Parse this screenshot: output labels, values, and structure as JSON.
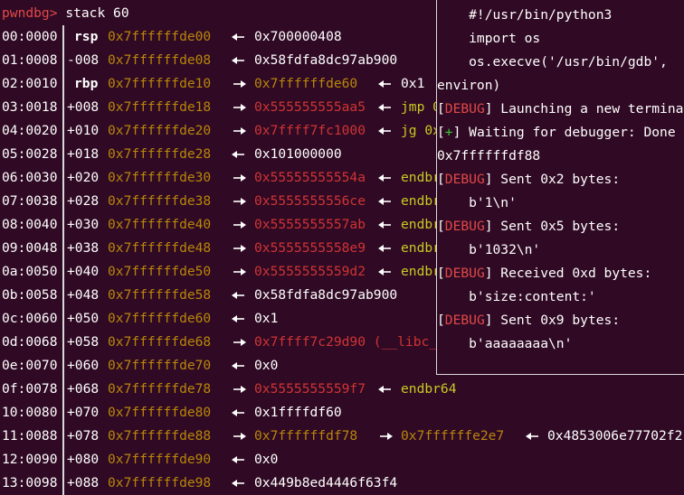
{
  "prompt": {
    "name": "pwndbg>",
    "command": "stack 60"
  },
  "stack": [
    {
      "off": "00:0000",
      "reg": "rsp",
      "roff": "",
      "addr": "0x7ffffffde00",
      "arrow": "left",
      "v1": "0x700000408",
      "v1c": "white",
      "v2": "",
      "v2c": "",
      "v3": "",
      "v3c": ""
    },
    {
      "off": "01:0008",
      "reg": "",
      "roff": "-008",
      "addr": "0x7ffffffde08",
      "arrow": "left",
      "v1": "0x58fdfa8dc97ab900",
      "v1c": "white",
      "v2": "",
      "v2c": "",
      "v3": "",
      "v3c": ""
    },
    {
      "off": "02:0010",
      "reg": "rbp",
      "roff": "",
      "addr": "0x7ffffffde10",
      "arrow": "right",
      "v1": "0x7ffffffde60",
      "v1c": "gold",
      "arrow2": "left",
      "v2": "0x1",
      "v2c": "white",
      "v3": "",
      "v3c": ""
    },
    {
      "off": "03:0018",
      "reg": "",
      "roff": "+008",
      "addr": "0x7ffffffde18",
      "arrow": "right",
      "v1": "0x555555555aa5",
      "v1c": "red",
      "arrow2": "left",
      "v2": "jmp 0",
      "v2c": "yellow",
      "v3": "",
      "v3c": ""
    },
    {
      "off": "04:0020",
      "reg": "",
      "roff": "+010",
      "addr": "0x7ffffffde20",
      "arrow": "right",
      "v1": "0x7ffff7fc1000",
      "v1c": "red",
      "arrow2": "left",
      "v2": "jg 0x",
      "v2c": "yellow",
      "v3": "",
      "v3c": ""
    },
    {
      "off": "05:0028",
      "reg": "",
      "roff": "+018",
      "addr": "0x7ffffffde28",
      "arrow": "left",
      "v1": "0x101000000",
      "v1c": "white",
      "v2": "",
      "v2c": "",
      "v3": "",
      "v3c": ""
    },
    {
      "off": "06:0030",
      "reg": "",
      "roff": "+020",
      "addr": "0x7ffffffde30",
      "arrow": "right",
      "v1": "0x55555555554a",
      "v1c": "red",
      "arrow2": "left",
      "v2": "endbr",
      "v2c": "yellow",
      "v3": "",
      "v3c": ""
    },
    {
      "off": "07:0038",
      "reg": "",
      "roff": "+028",
      "addr": "0x7ffffffde38",
      "arrow": "right",
      "v1": "0x5555555556ce",
      "v1c": "red",
      "arrow2": "left",
      "v2": "endbr",
      "v2c": "yellow",
      "v3": "",
      "v3c": ""
    },
    {
      "off": "08:0040",
      "reg": "",
      "roff": "+030",
      "addr": "0x7ffffffde40",
      "arrow": "right",
      "v1": "0x5555555557ab",
      "v1c": "red",
      "arrow2": "left",
      "v2": "endbr",
      "v2c": "yellow",
      "v3": "",
      "v3c": ""
    },
    {
      "off": "09:0048",
      "reg": "",
      "roff": "+038",
      "addr": "0x7ffffffde48",
      "arrow": "right",
      "v1": "0x5555555558e9",
      "v1c": "red",
      "arrow2": "left",
      "v2": "endbr",
      "v2c": "yellow",
      "v3": "",
      "v3c": ""
    },
    {
      "off": "0a:0050",
      "reg": "",
      "roff": "+040",
      "addr": "0x7ffffffde50",
      "arrow": "right",
      "v1": "0x5555555559d2",
      "v1c": "red",
      "arrow2": "left",
      "v2": "endbr",
      "v2c": "yellow",
      "v3": "",
      "v3c": ""
    },
    {
      "off": "0b:0058",
      "reg": "",
      "roff": "+048",
      "addr": "0x7ffffffde58",
      "arrow": "left",
      "v1": "0x58fdfa8dc97ab900",
      "v1c": "white",
      "v2": "",
      "v2c": "",
      "v3": "",
      "v3c": ""
    },
    {
      "off": "0c:0060",
      "reg": "",
      "roff": "+050",
      "addr": "0x7ffffffde60",
      "arrow": "left",
      "v1": "0x1",
      "v1c": "white",
      "v2": "",
      "v2c": "",
      "v3": "",
      "v3c": ""
    },
    {
      "off": "0d:0068",
      "reg": "",
      "roff": "+058",
      "addr": "0x7ffffffde68",
      "arrow": "right",
      "v1": "0x7ffff7c29d90 (__libc_",
      "v1c": "red",
      "v2": "",
      "v2c": "",
      "v3": "",
      "v3c": ""
    },
    {
      "off": "0e:0070",
      "reg": "",
      "roff": "+060",
      "addr": "0x7ffffffde70",
      "arrow": "left",
      "v1": "0x0",
      "v1c": "white",
      "v2": "",
      "v2c": "",
      "v3": "",
      "v3c": ""
    },
    {
      "off": "0f:0078",
      "reg": "",
      "roff": "+068",
      "addr": "0x7ffffffde78",
      "arrow": "right",
      "v1": "0x5555555559f7",
      "v1c": "red",
      "arrow2": "left",
      "v2": "endbr64",
      "v2c": "yellow",
      "v3": "",
      "v3c": ""
    },
    {
      "off": "10:0080",
      "reg": "",
      "roff": "+070",
      "addr": "0x7ffffffde80",
      "arrow": "left",
      "v1": "0x1ffffdf60",
      "v1c": "white",
      "v2": "",
      "v2c": "",
      "v3": "",
      "v3c": ""
    },
    {
      "off": "11:0088",
      "reg": "",
      "roff": "+078",
      "addr": "0x7ffffffde88",
      "arrow": "right",
      "v1": "0x7ffffffdf78",
      "v1c": "gold",
      "arrow2": "right",
      "v2": "0x7ffffffe2e7",
      "v2c": "gold",
      "arrow3": "left",
      "v3": "0x4853006e77702f2",
      "v3c": "white"
    },
    {
      "off": "12:0090",
      "reg": "",
      "roff": "+080",
      "addr": "0x7ffffffde90",
      "arrow": "left",
      "v1": "0x0",
      "v1c": "white",
      "v2": "",
      "v2c": "",
      "v3": "",
      "v3c": ""
    },
    {
      "off": "13:0098",
      "reg": "",
      "roff": "+088",
      "addr": "0x7ffffffde98",
      "arrow": "left",
      "v1": "0x449b8ed4446f63f4",
      "v1c": "white",
      "v2": "",
      "v2c": "",
      "v3": "",
      "v3c": ""
    }
  ],
  "pane": [
    {
      "parts": [
        {
          "t": "    #!/usr/bin/python3",
          "c": ""
        }
      ]
    },
    {
      "parts": [
        {
          "t": "    import os",
          "c": ""
        }
      ]
    },
    {
      "parts": [
        {
          "t": "    os.execve('/usr/bin/gdb',",
          "c": ""
        }
      ]
    },
    {
      "parts": [
        {
          "t": "environ)",
          "c": ""
        }
      ]
    },
    {
      "parts": [
        {
          "t": "[",
          "c": ""
        },
        {
          "t": "DEBUG",
          "c": "dbg"
        },
        {
          "t": "] Launching a new termina",
          "c": ""
        }
      ]
    },
    {
      "parts": [
        {
          "t": "[",
          "c": ""
        },
        {
          "t": "+",
          "c": "plus"
        },
        {
          "t": "] Waiting for debugger: Done",
          "c": ""
        }
      ]
    },
    {
      "parts": [
        {
          "t": "0x7ffffffdf88",
          "c": ""
        }
      ]
    },
    {
      "parts": [
        {
          "t": "[",
          "c": ""
        },
        {
          "t": "DEBUG",
          "c": "dbg"
        },
        {
          "t": "] Sent 0x2 bytes:",
          "c": ""
        }
      ]
    },
    {
      "parts": [
        {
          "t": "    b'1\\n'",
          "c": ""
        }
      ]
    },
    {
      "parts": [
        {
          "t": "[",
          "c": ""
        },
        {
          "t": "DEBUG",
          "c": "dbg"
        },
        {
          "t": "] Sent 0x5 bytes:",
          "c": ""
        }
      ]
    },
    {
      "parts": [
        {
          "t": "    b'1032\\n'",
          "c": ""
        }
      ]
    },
    {
      "parts": [
        {
          "t": "[",
          "c": ""
        },
        {
          "t": "DEBUG",
          "c": "dbg"
        },
        {
          "t": "] Received 0xd bytes:",
          "c": ""
        }
      ]
    },
    {
      "parts": [
        {
          "t": "    b'size:content:'",
          "c": ""
        }
      ]
    },
    {
      "parts": [
        {
          "t": "[",
          "c": ""
        },
        {
          "t": "DEBUG",
          "c": "dbg"
        },
        {
          "t": "] Sent 0x9 bytes:",
          "c": ""
        }
      ]
    },
    {
      "parts": [
        {
          "t": "    b'aaaaaaaa\\n'",
          "c": ""
        }
      ]
    }
  ],
  "colors": {
    "background": "#300a24",
    "white": "#ffffff",
    "gold": "#b8860b",
    "red": "#d03434",
    "yellow": "#c9c924",
    "prompt": "#e04848",
    "plus": "#33cc33"
  }
}
